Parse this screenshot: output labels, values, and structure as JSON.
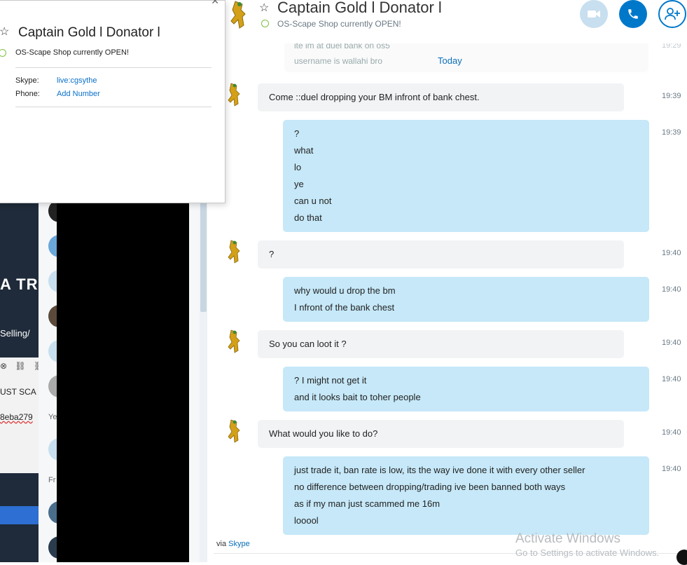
{
  "popup": {
    "name": "Captain Gold l Donator l",
    "status": "OS-Scape Shop currently OPEN!",
    "skype_label": "Skype:",
    "skype_value": "live:cgsythe",
    "phone_label": "Phone:",
    "phone_value": "Add Number"
  },
  "header": {
    "title": "Captain Gold l Donator l",
    "status": "OS-Scape Shop currently OPEN!"
  },
  "background_fragments": {
    "atr": "A TR",
    "selling": "Selling/",
    "just": "UST SCA",
    "hash": "8eba279",
    "ye": "Ye",
    "fr": "Fr"
  },
  "old_messages": [
    "ite im at duel bank on os5",
    "username is wallahi bro"
  ],
  "old_time": "19:29",
  "date_separator": "Today",
  "messages": [
    {
      "dir": "in",
      "lines": [
        "Come ::duel dropping your BM infront of bank chest."
      ],
      "time": "19:39"
    },
    {
      "dir": "out",
      "lines": [
        "?",
        "what",
        "lo",
        "ye",
        "can u not",
        "do that"
      ],
      "time": "19:39"
    },
    {
      "dir": "in",
      "lines": [
        "?"
      ],
      "time": "19:40"
    },
    {
      "dir": "out",
      "lines": [
        "why would u drop the bm",
        "I nfront of the bank chest"
      ],
      "time": "19:40"
    },
    {
      "dir": "in",
      "lines": [
        "So you can loot it ?"
      ],
      "time": "19:40"
    },
    {
      "dir": "out",
      "lines": [
        "? I might not get it",
        "and it looks bait to toher people"
      ],
      "time": "19:40"
    },
    {
      "dir": "in",
      "lines": [
        "What would you like to do?"
      ],
      "time": "19:40"
    },
    {
      "dir": "out",
      "lines": [
        "just trade it, ban rate is low, its the way ive done it with every other seller",
        "no difference between dropping/trading ive been banned both ways",
        "as if my man just scammed me 16m",
        "looool"
      ],
      "time": "19:40"
    }
  ],
  "footer": {
    "via": "via",
    "via_link": "Skype"
  },
  "watermark": {
    "title": "Activate Windows",
    "subtitle": "Go to Settings to activate Windows."
  },
  "colors": {
    "accent": "#0078ca",
    "outgoing_bubble": "#c6e8f8",
    "incoming_bubble": "#f1f3f5",
    "status_online": "#7cc242"
  }
}
